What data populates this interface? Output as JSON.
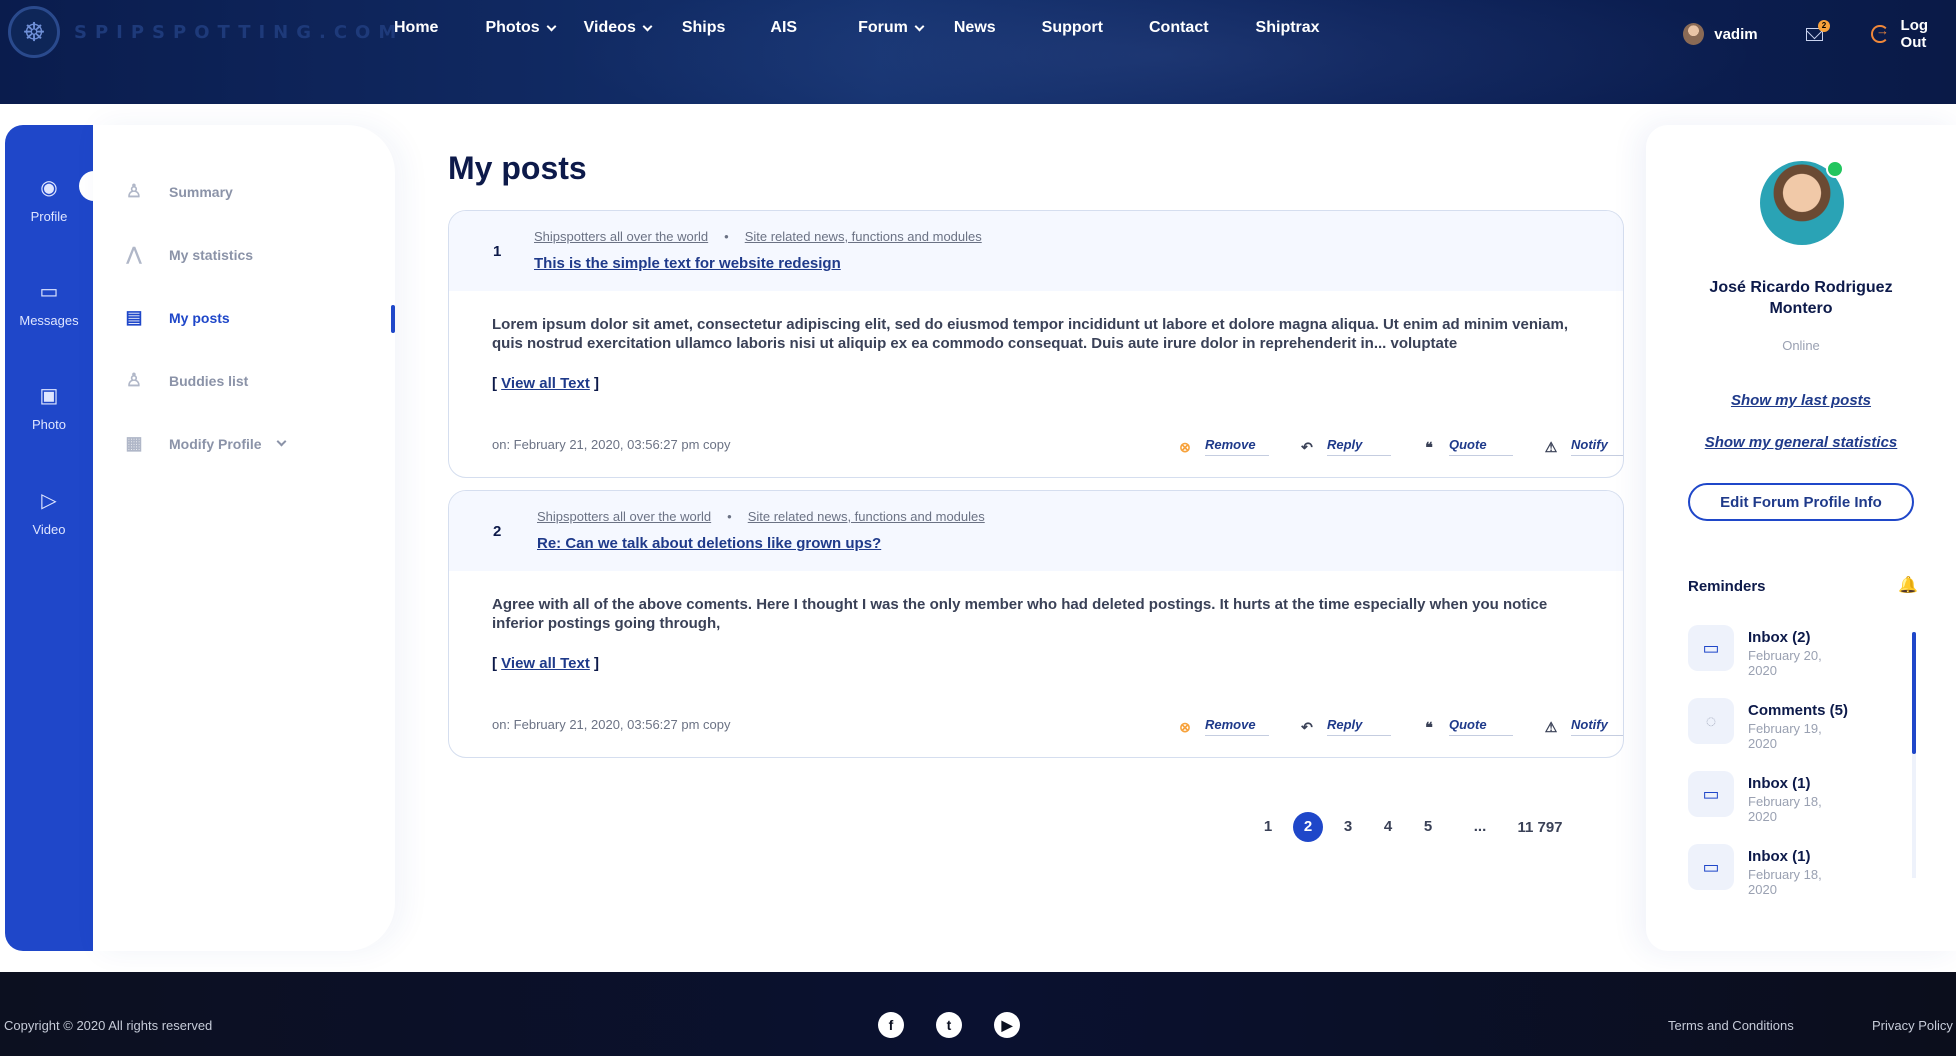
{
  "brand": {
    "logo_text": "SPIPSPOTTING.COM",
    "accent": "#1f47c9"
  },
  "nav": {
    "items": [
      {
        "label": "Home",
        "has_dropdown": false
      },
      {
        "label": "Photos",
        "has_dropdown": true
      },
      {
        "label": "Videos",
        "has_dropdown": true
      },
      {
        "label": "Ships",
        "has_dropdown": false
      },
      {
        "label": "AIS",
        "has_dropdown": false
      },
      {
        "label": "Forum",
        "has_dropdown": true
      },
      {
        "label": "News",
        "has_dropdown": false
      },
      {
        "label": "Support",
        "has_dropdown": false
      },
      {
        "label": "Contact",
        "has_dropdown": false
      },
      {
        "label": "Shiptrax",
        "has_dropdown": false
      }
    ]
  },
  "user": {
    "name": "vadim",
    "mail_badge": "2",
    "logout_label": "Log Out"
  },
  "rail": {
    "items": [
      {
        "label": "Profile",
        "icon": "user-circle-icon"
      },
      {
        "label": "Messages",
        "icon": "chat-icon"
      },
      {
        "label": "Photo",
        "icon": "image-icon"
      },
      {
        "label": "Video",
        "icon": "play-icon"
      }
    ]
  },
  "submenu": {
    "items": [
      {
        "label": "Summary",
        "icon": "user-icon"
      },
      {
        "label": "My statistics",
        "icon": "chart-icon"
      },
      {
        "label": "My posts",
        "icon": "document-icon",
        "active": true
      },
      {
        "label": "Buddies list",
        "icon": "users-icon"
      },
      {
        "label": "Modify Profile",
        "icon": "edit-doc-icon",
        "has_dropdown": true
      }
    ]
  },
  "main": {
    "title": "My posts",
    "posts": [
      {
        "number": "1",
        "crumb1": "Shipspotters all over the world",
        "crumb2": "Site related news, functions and modules",
        "title": "This is the simple text for website redesign",
        "body": "Lorem ipsum dolor sit amet, consectetur adipiscing elit, sed do eiusmod tempor incididunt ut labore et dolore magna aliqua. Ut enim ad minim veniam, quis nostrud exercitation ullamco laboris nisi ut aliquip ex ea commodo consequat. Duis aute irure dolor in reprehenderit in... voluptate",
        "date": "on: February 21, 2020, 03:56:27 pm copy"
      },
      {
        "number": "2",
        "crumb1": "Shipspotters all over the world",
        "crumb2": "Site related news, functions and modules",
        "title": "Re: Can we talk about deletions like grown ups?",
        "body": "Agree with all of the above coments. Here I thought I was the only member who had deleted postings. It hurts at the time especially when you notice inferior postings going through,",
        "date": "on: February 21, 2020, 03:56:27 pm copy"
      }
    ],
    "view_all": {
      "open": "[ ",
      "label": "View all Text",
      "close": " ]"
    },
    "actions": {
      "remove": "Remove",
      "reply": "Reply",
      "quote": "Quote",
      "notify": "Notify"
    }
  },
  "pagination": {
    "pages": [
      "1",
      "2",
      "3",
      "4",
      "5",
      "...",
      "11 797"
    ],
    "current": "2"
  },
  "profile": {
    "name": "José Ricardo Rodriguez Montero",
    "status": "Online",
    "last_posts_link": "Show my last posts",
    "stats_link": "Show my general statistics",
    "edit_button": "Edit Forum Profile Info"
  },
  "reminders": {
    "title": "Reminders",
    "items": [
      {
        "title": "Inbox (2)",
        "date": "February 20, 2020",
        "icon": "chat-icon"
      },
      {
        "title": "Comments (5)",
        "date": "February 19, 2020",
        "icon": "comment-icon"
      },
      {
        "title": "Inbox (1)",
        "date": "February 18, 2020",
        "icon": "chat-icon"
      },
      {
        "title": "Inbox (1)",
        "date": "February 18, 2020",
        "icon": "chat-icon"
      }
    ]
  },
  "footer": {
    "copyright": "Copyright © 2020 All rights reserved",
    "terms": "Terms and Conditions",
    "privacy": "Privacy Policy",
    "socials": [
      "facebook-icon",
      "twitter-icon",
      "youtube-icon"
    ]
  }
}
